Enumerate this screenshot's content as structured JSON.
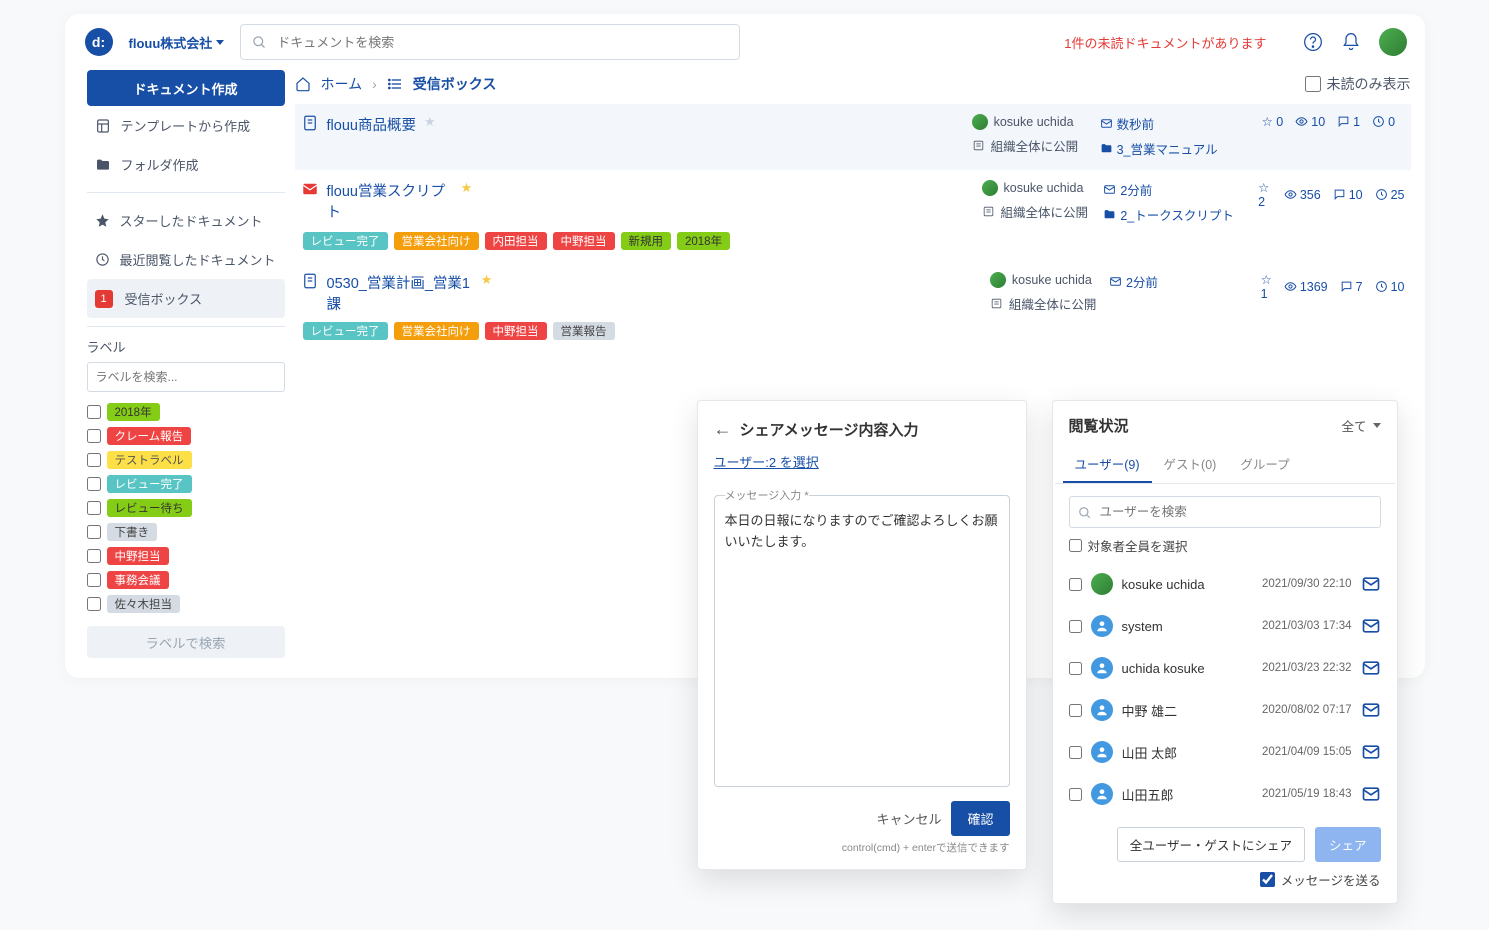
{
  "header": {
    "org_name": "flouu株式会社",
    "search_placeholder": "ドキュメントを検索",
    "unread_notice": "1件の未読ドキュメントがあります"
  },
  "sidebar": {
    "create_doc": "ドキュメント作成",
    "from_template": "テンプレートから作成",
    "create_folder": "フォルダ作成",
    "starred": "スターしたドキュメント",
    "recent": "最近閲覧したドキュメント",
    "inbox_badge": "1",
    "inbox": "受信ボックス",
    "label_section": "ラベル",
    "label_search_placeholder": "ラベルを検索...",
    "labels": [
      {
        "name": "2018年",
        "color": "c-green"
      },
      {
        "name": "クレーム報告",
        "color": "c-red"
      },
      {
        "name": "テストラベル",
        "color": "c-yel"
      },
      {
        "name": "レビュー完了",
        "color": "c-teal"
      },
      {
        "name": "レビュー待ち",
        "color": "c-green"
      },
      {
        "name": "下書き",
        "color": "c-grey"
      },
      {
        "name": "中野担当",
        "color": "c-red"
      },
      {
        "name": "事務会議",
        "color": "c-red"
      },
      {
        "name": "佐々木担当",
        "color": "c-grey"
      }
    ],
    "label_search_btn": "ラベルで検索"
  },
  "breadcrumb": {
    "home": "ホーム",
    "current": "受信ボックス",
    "unread_only": "未読のみ表示"
  },
  "docs": [
    {
      "title": "flouu商品概要",
      "starred": false,
      "author": "kosuke uchida",
      "visibility": "組織全体に公開",
      "time": "数秒前",
      "folder": "3_営業マニュアル",
      "stats": {
        "star": "0",
        "views": "10",
        "comments": "1",
        "history": "0"
      },
      "selected": true,
      "icon": "doc",
      "tags": []
    },
    {
      "title": "flouu営業スクリプト",
      "starred": true,
      "author": "kosuke uchida",
      "visibility": "組織全体に公開",
      "time": "2分前",
      "folder": "2_トークスクリプト",
      "stats": {
        "star": "2",
        "views": "356",
        "comments": "10",
        "history": "25"
      },
      "selected": false,
      "icon": "mail",
      "tags": [
        {
          "name": "レビュー完了",
          "color": "c-teal"
        },
        {
          "name": "営業会社向け",
          "color": "c-orange"
        },
        {
          "name": "内田担当",
          "color": "c-red"
        },
        {
          "name": "中野担当",
          "color": "c-red"
        },
        {
          "name": "新規用",
          "color": "c-green"
        },
        {
          "name": "2018年",
          "color": "c-green"
        }
      ]
    },
    {
      "title": "0530_営業計画_営業1課",
      "starred": true,
      "author": "kosuke uchida",
      "visibility": "組織全体に公開",
      "time": "2分前",
      "folder": "",
      "stats": {
        "star": "1",
        "views": "1369",
        "comments": "7",
        "history": "10"
      },
      "selected": false,
      "icon": "doc",
      "tags": [
        {
          "name": "レビュー完了",
          "color": "c-teal"
        },
        {
          "name": "営業会社向け",
          "color": "c-orange"
        },
        {
          "name": "中野担当",
          "color": "c-red"
        },
        {
          "name": "営業報告",
          "color": "c-grey"
        }
      ]
    }
  ],
  "share_dialog": {
    "title": "シェアメッセージ内容入力",
    "user_select": "ユーザー:2 を選択",
    "msg_label": "メッセージ入力 *",
    "msg_value": "本日の日報になりますのでご確認よろしくお願いいたします。",
    "cancel": "キャンセル",
    "confirm": "確認",
    "hint": "control(cmd) + enterで送信できます"
  },
  "status_dialog": {
    "title": "閲覧状況",
    "filter_all": "全て",
    "tabs": {
      "users": "ユーザー(9)",
      "guests": "ゲスト(0)",
      "groups": "グループ"
    },
    "user_search_placeholder": "ユーザーを検索",
    "select_all": "対象者全員を選択",
    "users": [
      {
        "name": "kosuke uchida",
        "ts": "2021/09/30 22:10",
        "green": true
      },
      {
        "name": "system",
        "ts": "2021/03/03 17:34",
        "green": false
      },
      {
        "name": "uchida kosuke",
        "ts": "2021/03/23 22:32",
        "green": false
      },
      {
        "name": "中野 雄二",
        "ts": "2020/08/02 07:17",
        "green": false
      },
      {
        "name": "山田 太郎",
        "ts": "2021/04/09 15:05",
        "green": false
      },
      {
        "name": "山田五郎",
        "ts": "2021/05/19 18:43",
        "green": false
      }
    ],
    "share_all": "全ユーザー・ゲストにシェア",
    "share": "シェア",
    "send_message": "メッセージを送る"
  }
}
